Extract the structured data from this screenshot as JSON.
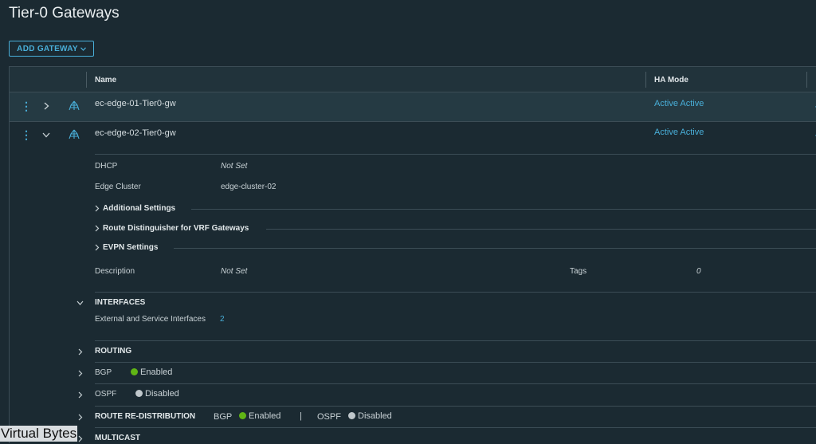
{
  "page": {
    "title": "Tier-0 Gateways"
  },
  "toolbar": {
    "add_gateway_label": "ADD GATEWAY"
  },
  "table": {
    "columns": {
      "name": "Name",
      "ha_mode": "HA Mode"
    },
    "rows": [
      {
        "name": "ec-edge-01-Tier0-gw",
        "ha_mode": "Active Active"
      },
      {
        "name": "ec-edge-02-Tier0-gw",
        "ha_mode": "Active Active"
      }
    ]
  },
  "details": {
    "dhcp_label": "DHCP",
    "dhcp_value": "Not Set",
    "edge_cluster_label": "Edge Cluster",
    "edge_cluster_value": "edge-cluster-02",
    "additional_settings": "Additional Settings",
    "route_distinguisher": "Route Distinguisher for VRF Gateways",
    "evpn_settings": "EVPN Settings",
    "description_label": "Description",
    "description_value": "Not Set",
    "tags_label": "Tags",
    "tags_value": "0"
  },
  "interfaces": {
    "title": "INTERFACES",
    "ext_label": "External and Service Interfaces",
    "ext_count": "2"
  },
  "routing": {
    "title": "ROUTING",
    "bgp_label": "BGP",
    "bgp_status": "Enabled",
    "ospf_label": "OSPF",
    "ospf_status": "Disabled",
    "redis_title": "ROUTE RE-DISTRIBUTION",
    "redis_bgp_label": "BGP",
    "redis_bgp_status": "Enabled",
    "redis_sep": "|",
    "redis_ospf_label": "OSPF",
    "redis_ospf_status": "Disabled"
  },
  "multicast": {
    "title": "MULTICAST"
  },
  "watermark": "Virtual Bytes",
  "colors": {
    "accent": "#49afd9",
    "enabled": "#60b515",
    "disabled": "#c0c8cc",
    "background": "#1b2a32"
  },
  "icons": [
    "kebab-menu-icon",
    "chevron-right-icon",
    "chevron-down-icon",
    "gateway-icon"
  ]
}
